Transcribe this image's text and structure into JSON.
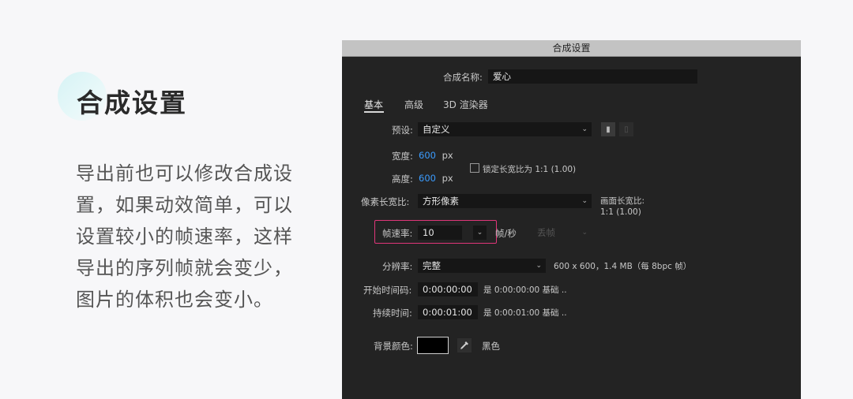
{
  "heading": "合成设置",
  "description": "导出前也可以修改合成设置，如果动效简单，可以设置较小的帧速率，这样导出的序列帧就会变少，图片的体积也会变小。",
  "dialog": {
    "title": "合成设置",
    "name_label": "合成名称:",
    "name_value": "爱心",
    "tabs": [
      "基本",
      "高级",
      "3D 渲染器"
    ],
    "preset_label": "预设:",
    "preset_value": "自定义",
    "width_label": "宽度:",
    "width_value": "600",
    "height_label": "高度:",
    "height_value": "600",
    "unit_px": "px",
    "lock_ratio_label": "锁定长宽比为 1:1 (1.00)",
    "pixel_ratio_label": "像素长宽比:",
    "pixel_ratio_value": "方形像素",
    "frame_ratio_label": "画面长宽比:",
    "frame_ratio_value": "1:1 (1.00)",
    "fps_label": "帧速率:",
    "fps_value": "10",
    "fps_unit": "帧/秒",
    "drop_frame_value": "丢帧",
    "resolution_label": "分辨率:",
    "resolution_value": "完整",
    "resolution_info": "600 x 600，1.4 MB（每 8bpc 帧）",
    "start_tc_label": "开始时间码:",
    "start_tc_value": "0:00:00:00",
    "start_tc_info": "是 0:00:00:00  基础 ..",
    "duration_label": "持续时间:",
    "duration_value": "0:00:01:00",
    "duration_info": "是 0:00:01:00  基础 ..",
    "bg_color_label": "背景颜色:",
    "bg_color_name": "黑色",
    "bg_color_hex": "#000000"
  }
}
